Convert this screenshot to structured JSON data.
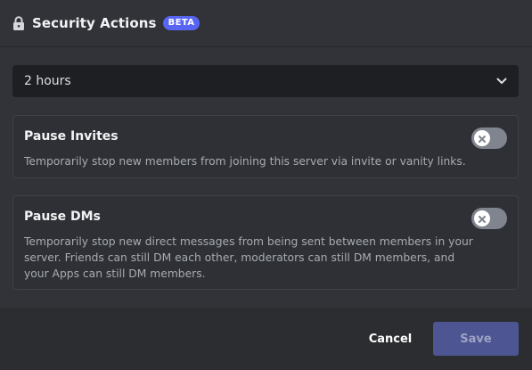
{
  "header": {
    "title": "Security Actions",
    "badge": "BETA",
    "icon": "lock-icon"
  },
  "duration_select": {
    "value": "2 hours",
    "icon": "chevron-down-icon"
  },
  "settings": [
    {
      "title": "Pause Invites",
      "description": "Temporarily stop new members from joining this server via invite or vanity links.",
      "enabled": false
    },
    {
      "title": "Pause DMs",
      "description": "Temporarily stop new direct messages from being sent between members in your server. Friends can still DM each other, moderators can still DM members, and your Apps can still DM members.",
      "enabled": false
    }
  ],
  "footer": {
    "cancel_label": "Cancel",
    "save_label": "Save"
  },
  "colors": {
    "accent": "#5865f2",
    "toggle_off": "#80848e",
    "save_disabled": "#4e5593"
  }
}
